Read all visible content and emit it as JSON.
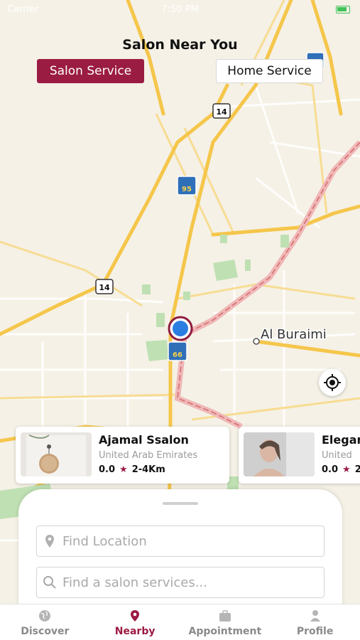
{
  "status": {
    "carrier": "Carrier",
    "time": "7:50 PM"
  },
  "page_title": "Salon Near You",
  "service_toggle": {
    "salon_label": "Salon Service",
    "home_label": "Home Service",
    "selected": "Salon Service"
  },
  "map": {
    "city_label": "Al Buraimi",
    "road_labels": [
      "14",
      "14",
      "95",
      "66"
    ],
    "marker_color": "#2a7de1",
    "marker_ring_color": "#8e1b3e"
  },
  "salons": [
    {
      "name": "Ajamal Ssalon",
      "country": "United Arab Emirates",
      "rating": "0.0",
      "distance": "2-4Km"
    },
    {
      "name": "Elegant",
      "country": "United",
      "rating": "0.0",
      "distance": "2"
    }
  ],
  "search": {
    "location_placeholder": "Find Location",
    "service_placeholder": "Find a salon services..."
  },
  "tabs": [
    {
      "label": "Discover",
      "icon": "globe-icon",
      "active": false
    },
    {
      "label": "Nearby",
      "icon": "location-pin-icon",
      "active": true
    },
    {
      "label": "Appointment",
      "icon": "briefcase-icon",
      "active": false
    },
    {
      "label": "Profile",
      "icon": "person-icon",
      "active": false
    }
  ],
  "colors": {
    "brand": "#9b1c43",
    "map_bg": "#f5f1e6",
    "road_major": "#f5c64b",
    "road_highway": "#f0b7b7"
  }
}
